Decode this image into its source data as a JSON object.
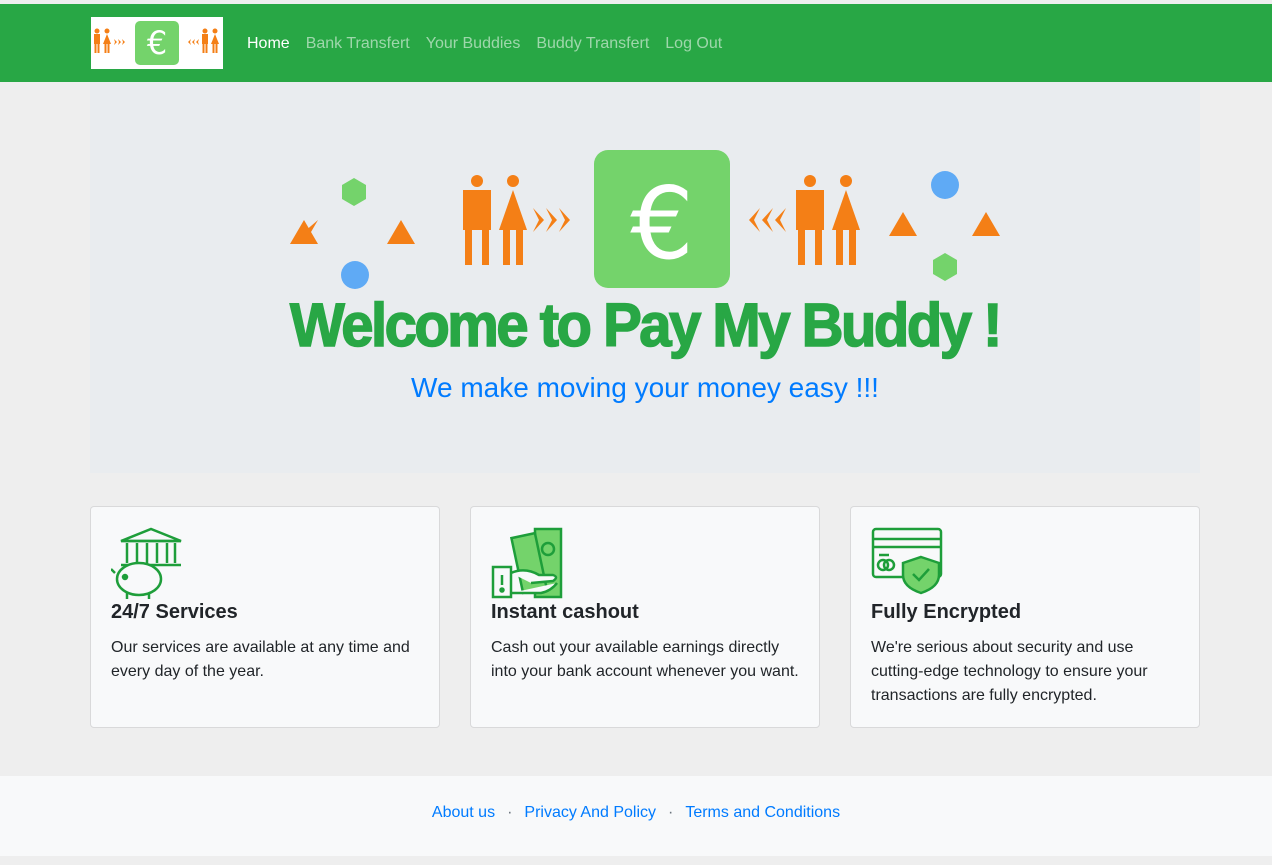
{
  "navbar": {
    "logo": "pay-my-buddy-logo",
    "links": [
      {
        "label": "Home",
        "active": true
      },
      {
        "label": "Bank Transfert",
        "active": false
      },
      {
        "label": "Your Buddies",
        "active": false
      },
      {
        "label": "Buddy Transfert",
        "active": false
      },
      {
        "label": "Log Out",
        "active": false
      }
    ]
  },
  "hero": {
    "title": "Welcome to Pay My Buddy !",
    "subtitle": "We make moving your money easy !!!"
  },
  "cards": [
    {
      "icon": "bank-piggy-icon",
      "title": "24/7 Services",
      "text": "Our services are available at any time and every day of the year."
    },
    {
      "icon": "cash-hand-icon",
      "title": "Instant cashout",
      "text": "Cash out your available earnings directly into your bank account whenever you want."
    },
    {
      "icon": "credit-card-shield-icon",
      "title": "Fully Encrypted",
      "text": "We're serious about security and use cutting-edge technology to ensure your transactions are fully encrypted."
    }
  ],
  "footer": {
    "links": [
      "About us",
      "Privacy And Policy",
      "Terms and Conditions"
    ],
    "separator": "·"
  },
  "colors": {
    "brand_green": "#28a745",
    "accent_orange": "#f47f16",
    "light_green": "#74d36b",
    "blue": "#007bff"
  }
}
